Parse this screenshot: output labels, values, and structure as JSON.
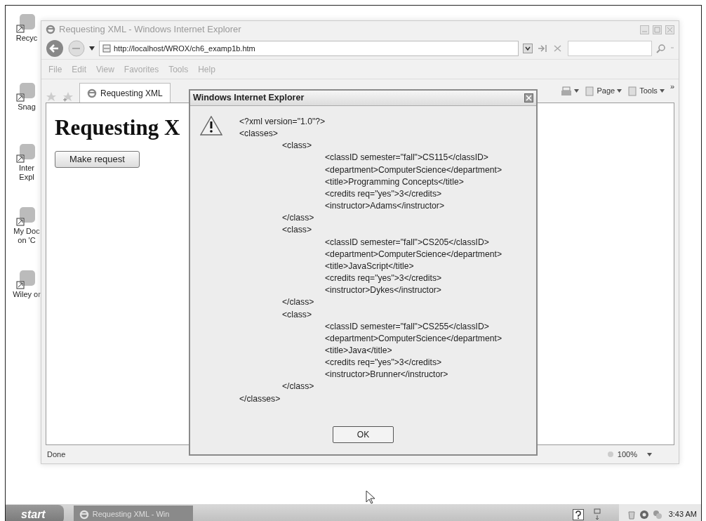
{
  "desktop_icons": [
    {
      "lines": [
        "Recyc"
      ]
    },
    {
      "lines": [
        "Snag"
      ]
    },
    {
      "lines": [
        "Inter",
        "Expl"
      ]
    },
    {
      "lines": [
        "My Doc",
        "on 'C"
      ]
    },
    {
      "lines": [
        "Wiley or"
      ]
    }
  ],
  "browser": {
    "title": "Requesting XML - Windows Internet Explorer",
    "address": "http://localhost/WROX/ch6_examp1b.htm",
    "menu": [
      "File",
      "Edit",
      "View",
      "Favorites",
      "Tools",
      "Help"
    ],
    "tabs": [
      {
        "label": "Requesting XML",
        "selected": true
      }
    ],
    "toolbar": [
      "Page",
      "Tools"
    ],
    "more": "»",
    "page": {
      "heading": "Requesting X",
      "button": "Make request"
    },
    "status": "Done",
    "zoom": "100%"
  },
  "dialog": {
    "title": "Windows Internet Explorer",
    "lines": [
      {
        "text": "<?xml version=\"1.0\"?>"
      },
      {
        "text": "<classes>",
        "children": [
          {
            "text": "<class>",
            "children": [
              {
                "text": "<classID semester=\"fall\">CS115</classID>"
              },
              {
                "text": "<department>ComputerScience</department>"
              },
              {
                "text": "<title>Programming Concepts</title>"
              },
              {
                "text": "<credits req=\"yes\">3</credits>"
              },
              {
                "text": "<instructor>Adams</instructor>"
              }
            ]
          },
          {
            "text": "</class>"
          },
          {
            "text": "<class>",
            "children": [
              {
                "text": "<classID semester=\"fall\">CS205</classID>"
              },
              {
                "text": "<department>ComputerScience</department>"
              },
              {
                "text": "<title>JavaScript</title>"
              },
              {
                "text": "<credits req=\"yes\">3</credits>"
              },
              {
                "text": "<instructor>Dykes</instructor>"
              }
            ]
          },
          {
            "text": "</class>"
          },
          {
            "text": "<class>",
            "children": [
              {
                "text": "<classID semester=\"fall\">CS255</classID>"
              },
              {
                "text": "<department>ComputerScience</department>"
              },
              {
                "text": "<title>Java</title>"
              },
              {
                "text": "<credits req=\"yes\">3</credits>"
              },
              {
                "text": "<instructor>Brunner</instructor>"
              }
            ]
          },
          {
            "text": "</class>"
          }
        ]
      },
      {
        "text": "</classes>"
      }
    ],
    "button": "OK"
  },
  "taskbar": {
    "start": "start",
    "task": "Requesting XML - Win",
    "time": "3:43 AM"
  }
}
